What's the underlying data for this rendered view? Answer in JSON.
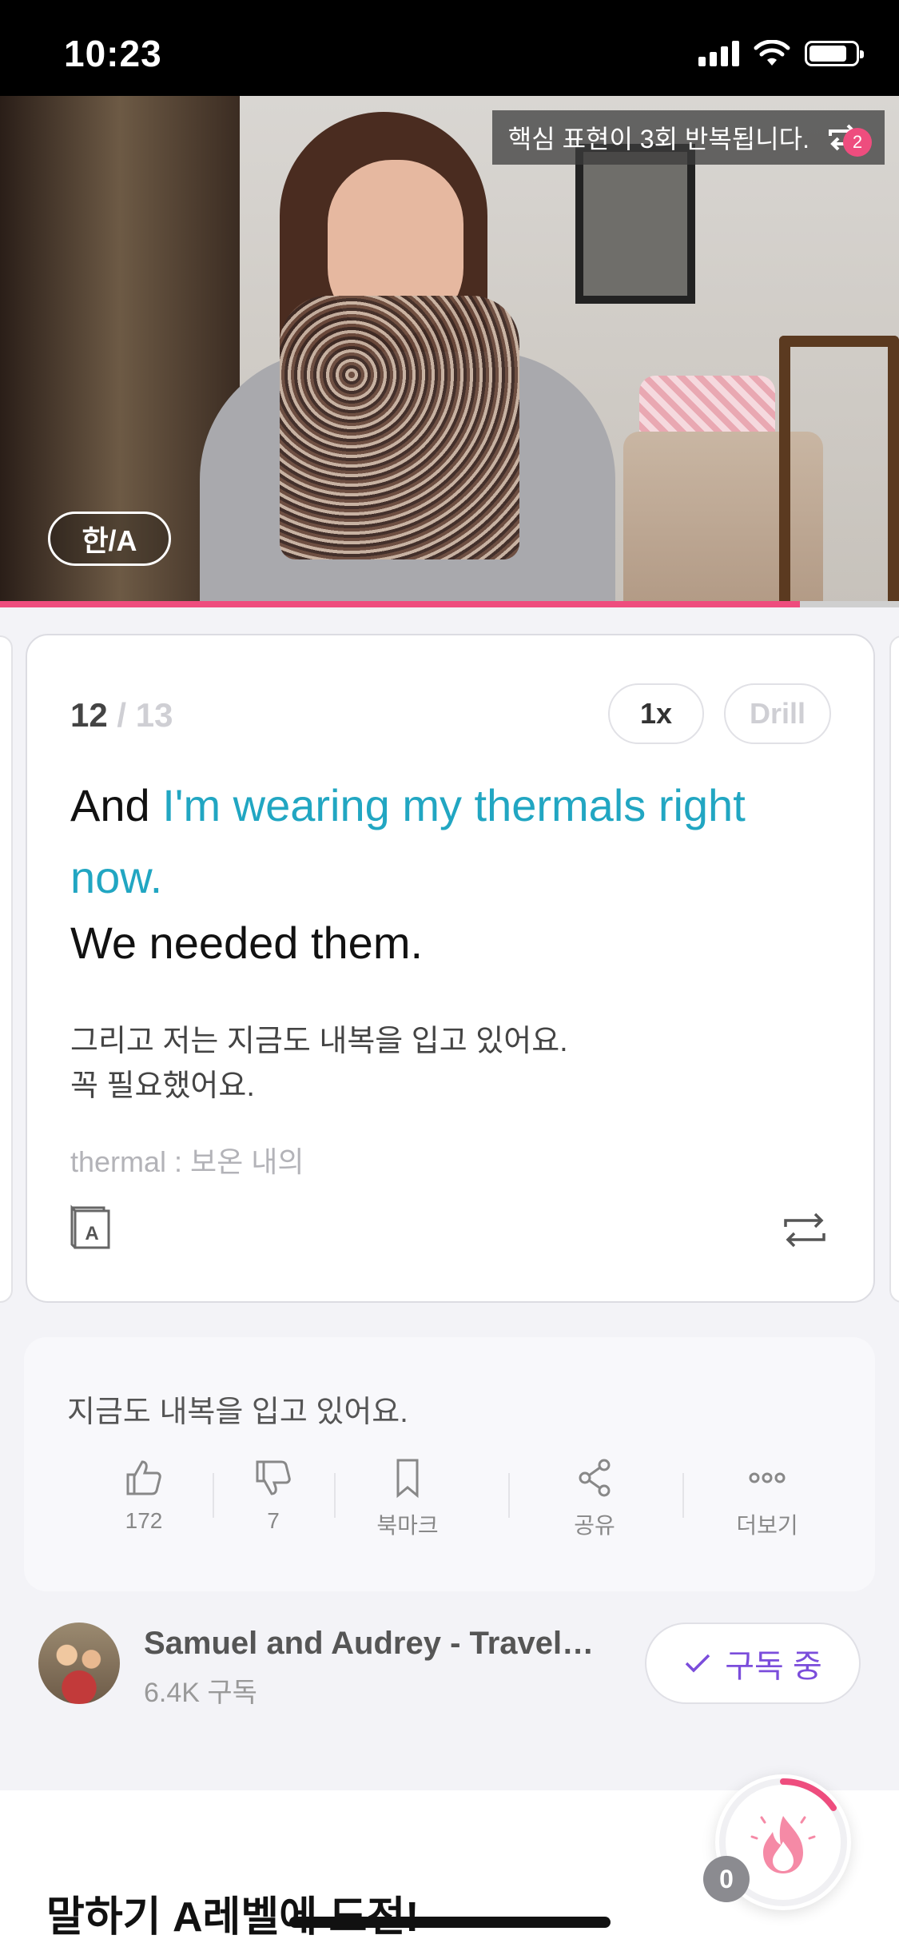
{
  "status_bar": {
    "time": "10:23"
  },
  "video": {
    "banner_text": "핵심 표현이 3회 반복됩니다.",
    "repeat_badge": "2",
    "lang_toggle": "한/A",
    "progress": 0.89,
    "accent_color": "#ee4d7e"
  },
  "card": {
    "current": "12",
    "total": "/ 13",
    "speed": "1x",
    "drill": "Drill",
    "en_plain": "And ",
    "en_highlight": "I'm wearing my thermals right now.",
    "en_line2": "We needed them.",
    "ko_line1": "그리고 저는 지금도 내복을 입고 있어요.",
    "ko_line2": "꼭 필요했어요.",
    "vocab": "thermal : 보온 내의",
    "highlight_color": "#21a6c2"
  },
  "info": {
    "sentence": "지금도 내복을 입고 있어요.",
    "actions": [
      {
        "icon": "thumbs-up-icon",
        "label": "172"
      },
      {
        "icon": "thumbs-down-icon",
        "label": "7"
      },
      {
        "icon": "bookmark-icon",
        "label": "북마크"
      },
      {
        "icon": "share-icon",
        "label": "공유"
      },
      {
        "icon": "more-icon",
        "label": "더보기"
      }
    ]
  },
  "channel": {
    "name": "Samuel and Audrey - Travel…",
    "subscribers": "6.4K 구독",
    "subscribe_label": "구독 중",
    "subscribe_color": "#7b4ddb"
  },
  "bottom": {
    "title": "말하기 A레벨에 도전!",
    "fire_count": "0"
  }
}
